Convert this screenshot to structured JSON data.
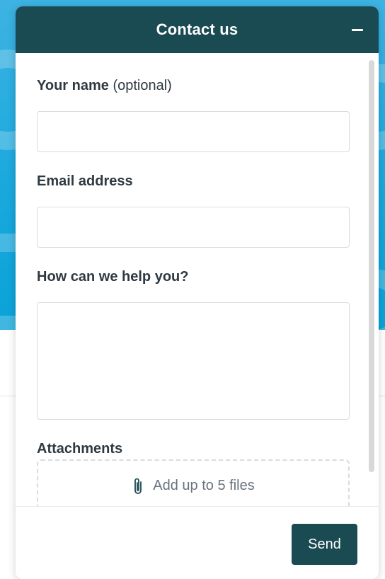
{
  "widget": {
    "title": "Contact us",
    "minimize_icon": "minus-icon"
  },
  "form": {
    "name": {
      "label": "Your name",
      "optional_suffix": "(optional)",
      "value": "",
      "placeholder": ""
    },
    "email": {
      "label": "Email address",
      "value": "",
      "placeholder": ""
    },
    "message": {
      "label": "How can we help you?",
      "value": "",
      "placeholder": ""
    },
    "attachments": {
      "label": "Attachments",
      "dropzone_text": "Add up to 5 files",
      "icon": "paperclip-icon"
    }
  },
  "footer": {
    "send_label": "Send"
  },
  "colors": {
    "header_bg": "#1a4a52",
    "button_bg": "#1a4a52",
    "hero_bg": "#18a8dc",
    "text": "#2f3941",
    "muted_text": "#68737d",
    "border": "#d8dcde"
  }
}
